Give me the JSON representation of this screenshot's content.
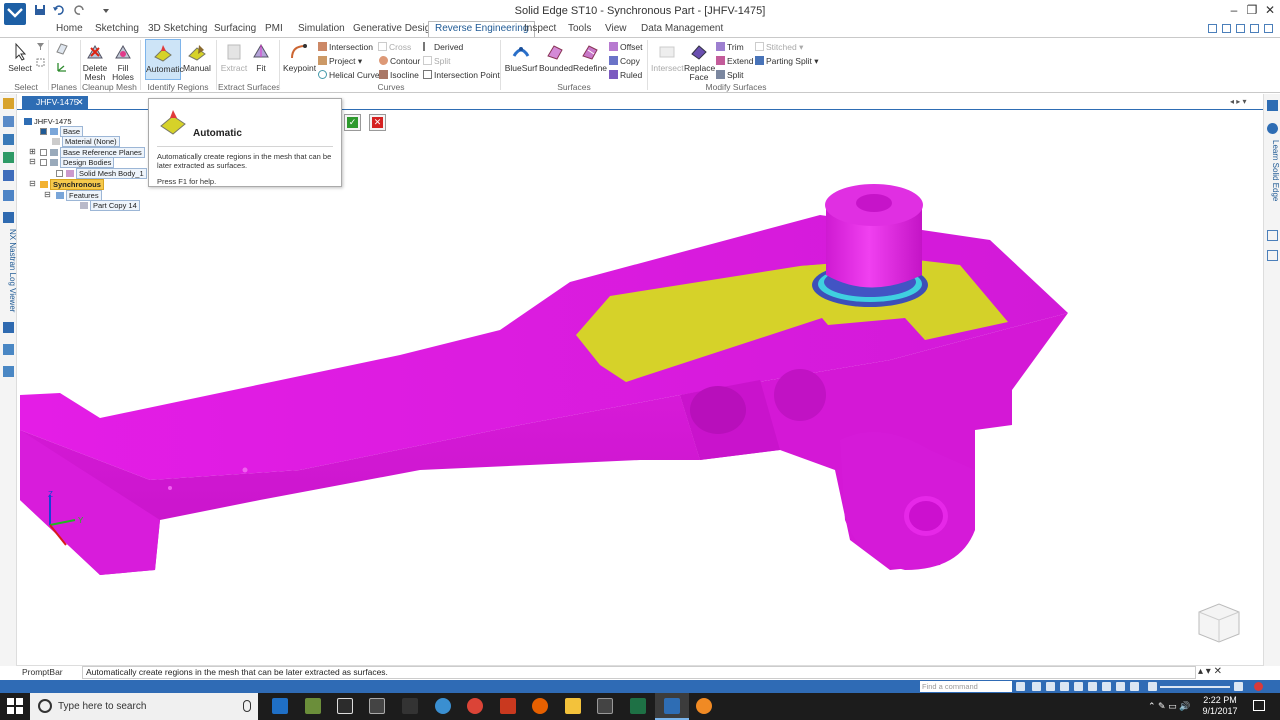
{
  "window": {
    "title": "Solid Edge ST10 - Synchronous Part - [JHFV-1475]",
    "minimize": "–",
    "restore": "❐",
    "close": "✕"
  },
  "ribbon_tabs": [
    {
      "label": "Home"
    },
    {
      "label": "Sketching"
    },
    {
      "label": "3D Sketching"
    },
    {
      "label": "Surfacing"
    },
    {
      "label": "PMI"
    },
    {
      "label": "Simulation"
    },
    {
      "label": "Generative Design"
    },
    {
      "label": "Reverse Engineering"
    },
    {
      "label": "Inspect"
    },
    {
      "label": "Tools"
    },
    {
      "label": "View"
    },
    {
      "label": "Data Management"
    }
  ],
  "ribbon": {
    "select_group": {
      "select_label": "Select",
      "group": "Select"
    },
    "planes_group": {
      "group": "Planes"
    },
    "cleanup_group": {
      "delete_mesh": "Delete Mesh",
      "fill_holes": "Fill Holes",
      "group": "Cleanup Mesh"
    },
    "identify_group": {
      "automatic": "Automatic",
      "manual": "Manual",
      "group": "Identify Regions"
    },
    "extract_group": {
      "extract": "Extract",
      "fit": "Fit",
      "group": "Extract Surfaces"
    },
    "curves_group": {
      "keypoint": "Keypoint",
      "intersection": "Intersection",
      "cross": "Cross",
      "derived": "Derived",
      "project": "Project",
      "split": "Split",
      "helical_curve": "Helical Curve",
      "contour": "Contour",
      "isocline": "Isocline",
      "intersection_point": "Intersection Point",
      "group": "Curves"
    },
    "surfaces_group": {
      "bluesurf": "BlueSurf",
      "bounded": "Bounded",
      "redefine": "Redefine",
      "offset": "Offset",
      "copy": "Copy",
      "ruled": "Ruled",
      "group": "Surfaces"
    },
    "modify_group": {
      "intersect": "Intersect",
      "replace_face": "Replace Face",
      "trim": "Trim",
      "extend": "Extend",
      "split": "Split",
      "stitched": "Stitched",
      "parting_split": "Parting Split",
      "group": "Modify Surfaces"
    }
  },
  "document_tab": {
    "label": "JHFV-1475",
    "close": "✕"
  },
  "tree": {
    "root": "JHFV-1475",
    "items": [
      {
        "label": "Base"
      },
      {
        "label": "Material (None)"
      },
      {
        "label": "Base Reference Planes"
      },
      {
        "label": "Design Bodies"
      },
      {
        "label": "Solid Mesh Body_1"
      },
      {
        "label": "Synchronous"
      },
      {
        "label": "Features"
      },
      {
        "label": "Part Copy 14"
      }
    ]
  },
  "tooltip": {
    "title": "Automatic",
    "description": "Automatically create regions in the mesh that can be later extracted as surfaces.",
    "help": "Press F1 for help."
  },
  "command": {
    "accept": "✓",
    "reject": "✕"
  },
  "side_panels": {
    "left": "NX Nastran Log Viewer",
    "right": "Learn Solid Edge"
  },
  "prompt_bar": {
    "label": "PromptBar",
    "text": "Automatically create regions in the mesh that can be later extracted as surfaces."
  },
  "status_bar": {
    "find_placeholder": "Find a command"
  },
  "taskbar": {
    "search_placeholder": "Type here to search",
    "time": "2:22 PM",
    "date": "9/1/2017"
  },
  "colors": {
    "accent": "#2e6db4",
    "part_magenta": "#e21ee6",
    "region_yellow": "#d6d229",
    "taskbar": "#1c1c1c"
  }
}
